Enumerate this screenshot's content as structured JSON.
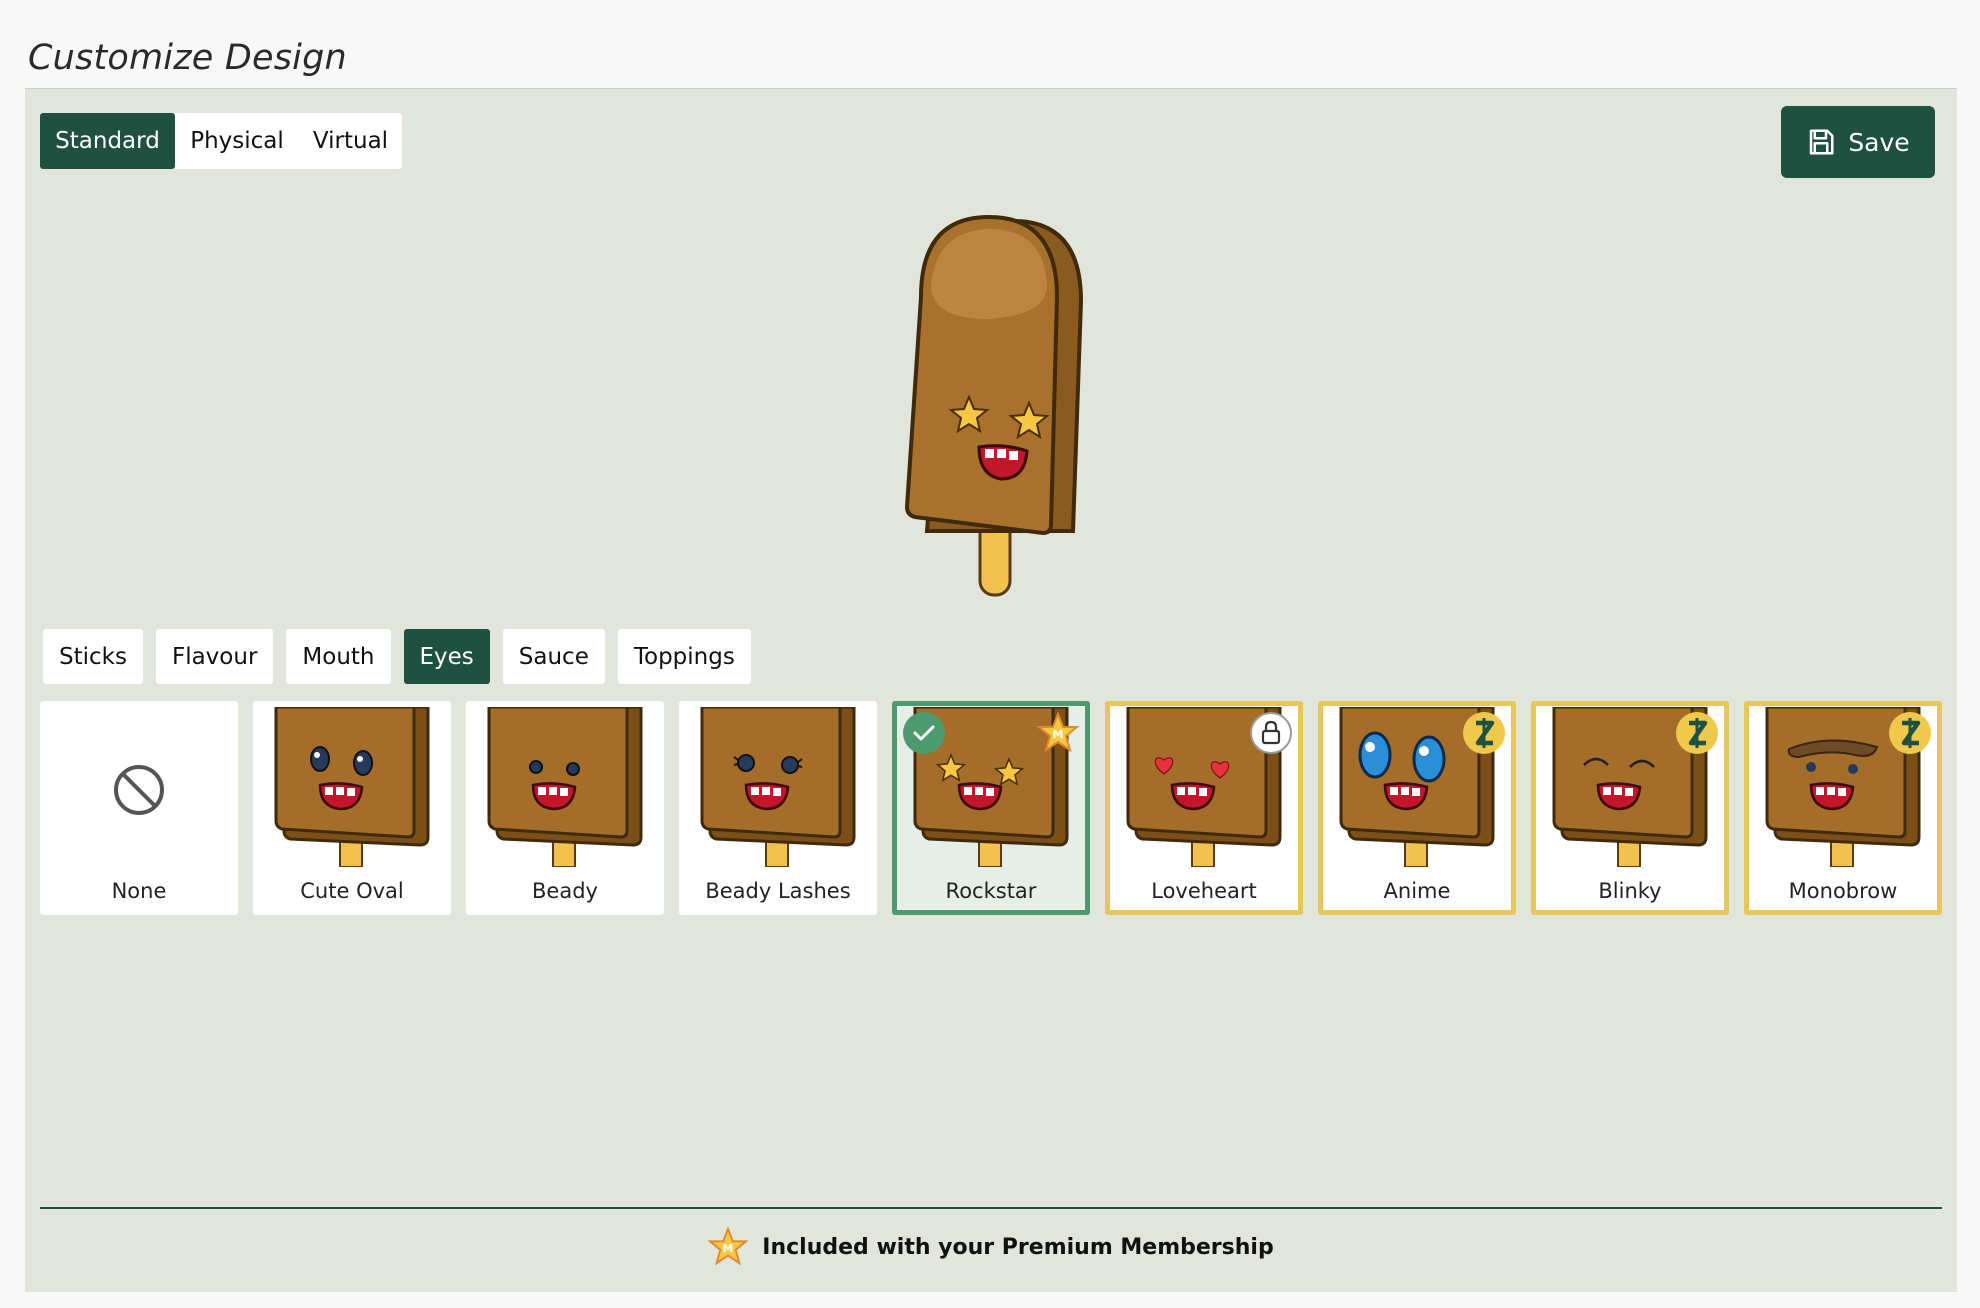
{
  "page": {
    "title": "Customize Design"
  },
  "mode_tabs": [
    {
      "label": "Standard",
      "active": true
    },
    {
      "label": "Physical",
      "active": false
    },
    {
      "label": "Virtual",
      "active": false
    }
  ],
  "save": {
    "label": "Save",
    "icon": "floppy-disk-icon"
  },
  "category_tabs": [
    {
      "label": "Sticks",
      "active": false
    },
    {
      "label": "Flavour",
      "active": false
    },
    {
      "label": "Mouth",
      "active": false
    },
    {
      "label": "Eyes",
      "active": true
    },
    {
      "label": "Sauce",
      "active": false
    },
    {
      "label": "Toppings",
      "active": false
    }
  ],
  "eye_options": [
    {
      "label": "None",
      "kind": "none",
      "status": "free"
    },
    {
      "label": "Cute Oval",
      "kind": "oval",
      "status": "free"
    },
    {
      "label": "Beady",
      "kind": "beady",
      "status": "free"
    },
    {
      "label": "Beady Lashes",
      "kind": "lashes",
      "status": "free"
    },
    {
      "label": "Rockstar",
      "kind": "star",
      "status": "selected-membership"
    },
    {
      "label": "Loveheart",
      "kind": "heart",
      "status": "locked"
    },
    {
      "label": "Anime",
      "kind": "anime",
      "status": "coin"
    },
    {
      "label": "Blinky",
      "kind": "blinky",
      "status": "coin"
    },
    {
      "label": "Monobrow",
      "kind": "monobrow",
      "status": "coin"
    }
  ],
  "footer": {
    "note": "Included with your Premium Membership",
    "icon": "membership-star-icon"
  },
  "colors": {
    "accent": "#1f5140",
    "selected_border": "#4e9a6f",
    "premium_border": "#e6c85a",
    "background": "#e1e5dc"
  }
}
